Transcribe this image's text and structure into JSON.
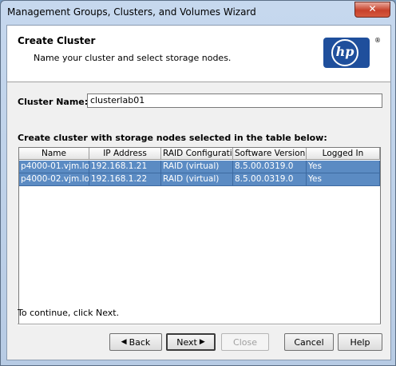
{
  "window": {
    "title": "Management Groups, Clusters, and Volumes Wizard",
    "close_glyph": "✕"
  },
  "header": {
    "title": "Create Cluster",
    "subtitle": "Name your cluster and select storage nodes.",
    "logo_text": "hp",
    "logo_mark": "®"
  },
  "cluster_name": {
    "label": "Cluster Name:",
    "value": "clusterlab01"
  },
  "table": {
    "caption": "Create cluster with storage nodes selected in the table below:",
    "columns": [
      "Name",
      "IP Address",
      "RAID Configurati...",
      "Software Version",
      "Logged In"
    ],
    "rows": [
      [
        "p4000-01.vjm.lo...",
        "192.168.1.21",
        "RAID (virtual)",
        "8.5.00.0319.0",
        "Yes"
      ],
      [
        "p4000-02.vjm.lo...",
        "192.168.1.22",
        "RAID (virtual)",
        "8.5.00.0319.0",
        "Yes"
      ]
    ],
    "selection_color": "#5b8bc3"
  },
  "footer": {
    "hint": "To continue, click Next.",
    "buttons": {
      "back": "Back",
      "next": "Next",
      "close": "Close",
      "cancel": "Cancel",
      "help": "Help"
    },
    "back_arrow": "◀",
    "next_arrow": "▶"
  }
}
